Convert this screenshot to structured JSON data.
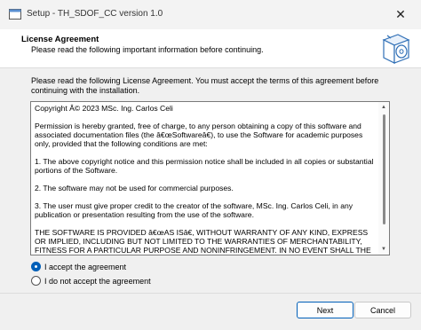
{
  "window": {
    "title": "Setup - TH_SDOF_CC version 1.0",
    "close_glyph": "✕"
  },
  "header": {
    "title": "License Agreement",
    "subtitle": "Please read the following important information before continuing."
  },
  "intro_text": "Please read the following License Agreement. You must accept the terms of this agreement before continuing with the installation.",
  "license": {
    "paragraphs": [
      "Copyright Â© 2023 MSc. Ing. Carlos Celi",
      "Permission is hereby granted, free of charge, to any person obtaining a copy of this software and associated documentation files (the â€œSoftwareâ€), to use the Software for academic purposes only, provided that the following conditions are met:",
      "1. The above copyright notice and this permission notice shall be included in all copies or substantial portions of the Software.",
      "2. The software may not be used for commercial purposes.",
      "3. The user must give proper credit to the creator of the software, MSc. Ing. Carlos Celi, in any publication or presentation resulting from the use of the software.",
      "THE SOFTWARE IS PROVIDED â€œAS ISâ€, WITHOUT WARRANTY OF ANY KIND, EXPRESS OR IMPLIED, INCLUDING BUT NOT LIMITED TO THE WARRANTIES OF MERCHANTABILITY, FITNESS FOR A PARTICULAR PURPOSE AND NONINFRINGEMENT. IN NO EVENT SHALL THE AUTHORS OR"
    ]
  },
  "options": {
    "accept_label": "I accept the agreement",
    "decline_label": "I do not accept the agreement",
    "selected": "accept"
  },
  "buttons": {
    "next": "Next",
    "cancel": "Cancel"
  },
  "colors": {
    "accent": "#005fb8"
  },
  "icons": {
    "app": "installer-icon",
    "header_graphic": "software-box-disc-icon"
  }
}
